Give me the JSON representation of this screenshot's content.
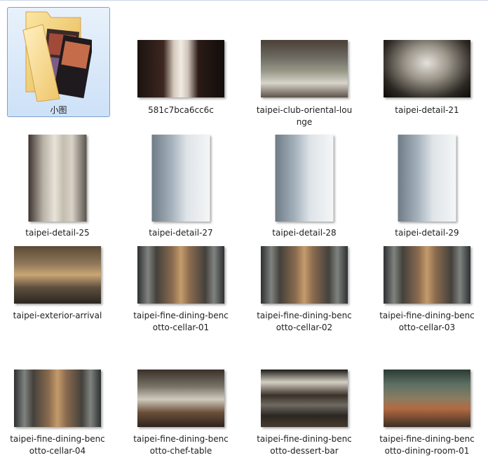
{
  "items": [
    {
      "name": "小图",
      "kind": "folder",
      "selected": true
    },
    {
      "name": "581c7bca6cc6c",
      "kind": "image",
      "style": "chef"
    },
    {
      "name": "taipei-club-oriental-lou\nnge",
      "kind": "image",
      "style": "lounge"
    },
    {
      "name": "taipei-detail-21",
      "kind": "image",
      "style": "chand"
    },
    {
      "name": "taipei-detail-25",
      "kind": "image",
      "style": "rhino"
    },
    {
      "name": "taipei-detail-27",
      "kind": "image",
      "style": "baby"
    },
    {
      "name": "taipei-detail-28",
      "kind": "image",
      "style": "baby"
    },
    {
      "name": "taipei-detail-29",
      "kind": "image",
      "style": "baby"
    },
    {
      "name": "taipei-exterior-arrival",
      "kind": "image",
      "style": "arrival"
    },
    {
      "name": "taipei-fine-dining-benc\notto-cellar-01",
      "kind": "image",
      "style": "cellar"
    },
    {
      "name": "taipei-fine-dining-benc\notto-cellar-02",
      "kind": "image",
      "style": "cellar"
    },
    {
      "name": "taipei-fine-dining-benc\notto-cellar-03",
      "kind": "image",
      "style": "cellar"
    },
    {
      "name": "taipei-fine-dining-benc\notto-cellar-04",
      "kind": "image",
      "style": "cellar"
    },
    {
      "name": "taipei-fine-dining-benc\notto-chef-table",
      "kind": "image",
      "style": "cheftable"
    },
    {
      "name": "taipei-fine-dining-benc\notto-dessert-bar",
      "kind": "image",
      "style": "dessert"
    },
    {
      "name": "taipei-fine-dining-benc\notto-dining-room-01",
      "kind": "image",
      "style": "dining"
    }
  ],
  "colors": {
    "selection_border": "#7da2ce",
    "folder_yellow": "#f1d27a"
  }
}
